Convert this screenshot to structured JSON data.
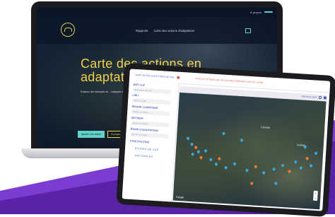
{
  "colors": {
    "accent_yellow": "#f0d24a",
    "accent_teal": "#62d1c9",
    "tablet_blue": "#4a5bbd",
    "tablet_red": "#d85a4a",
    "purple_bg": "#7c3bd1"
  },
  "laptop": {
    "topbar": {
      "left_text": "",
      "right_text": "À propos",
      "button_label": ""
    },
    "nav": {
      "links": [
        "Rapports",
        "Carte des actions d'adaptation"
      ],
      "right_label": ""
    },
    "title_lines": [
      "Carte des actions en",
      "adaptation"
    ],
    "description": "Explorez des exemples de ... impliqués dans ... changements climatiques ...",
    "action_buttons": [
      "Ajouter une action",
      "À propos",
      "Contribuer à la carte"
    ]
  },
  "tablet": {
    "header_left": "VOIR TOUTES LES ÉTUDES DE CAS",
    "header_right": "VOIR LES ÉTUDES DE CAS QUI MENTIONNENT SUR LE CLIMAT",
    "sidebar": {
      "fields": [
        {
          "label": "MOT CLÉ",
          "placeholder": "Rechercher par mot"
        },
        {
          "label": "LIEU",
          "placeholder": "Ajouter un lieu"
        },
        {
          "label": "RISQUE CLIMATIQUE",
          "placeholder": "Ajouter un risque"
        },
        {
          "label": "SECTEUR",
          "placeholder": "Ajouter un secteur"
        },
        {
          "label": "ÉTAPE D'ADAPTATION",
          "placeholder": "Ajouter une étape"
        },
        {
          "label": "TYPE D'ACTION",
          "placeholder": ""
        }
      ],
      "links": [
        "ÉTUDES DE CAS",
        "NATIONALES"
      ]
    },
    "map": {
      "toolbar_text": "RÉINITIALISER",
      "labels": [
        "Canada",
        "Québec"
      ],
      "attribution": "Google"
    }
  }
}
